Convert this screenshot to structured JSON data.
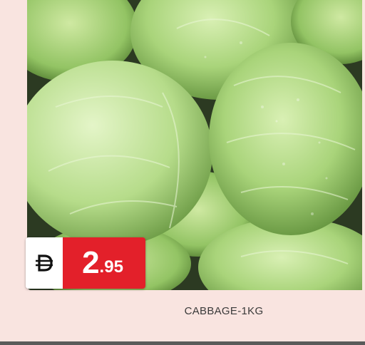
{
  "product": {
    "name": "CABBAGE-1KG",
    "image_subject": "cabbage-photo"
  },
  "price": {
    "currency_icon": "dirham-icon",
    "integer": "2",
    "decimal": ".95"
  },
  "colors": {
    "background": "#f9e4e0",
    "price_red": "#e3202a",
    "currency_bg": "#ffffff",
    "text": "#3a3a3a"
  }
}
